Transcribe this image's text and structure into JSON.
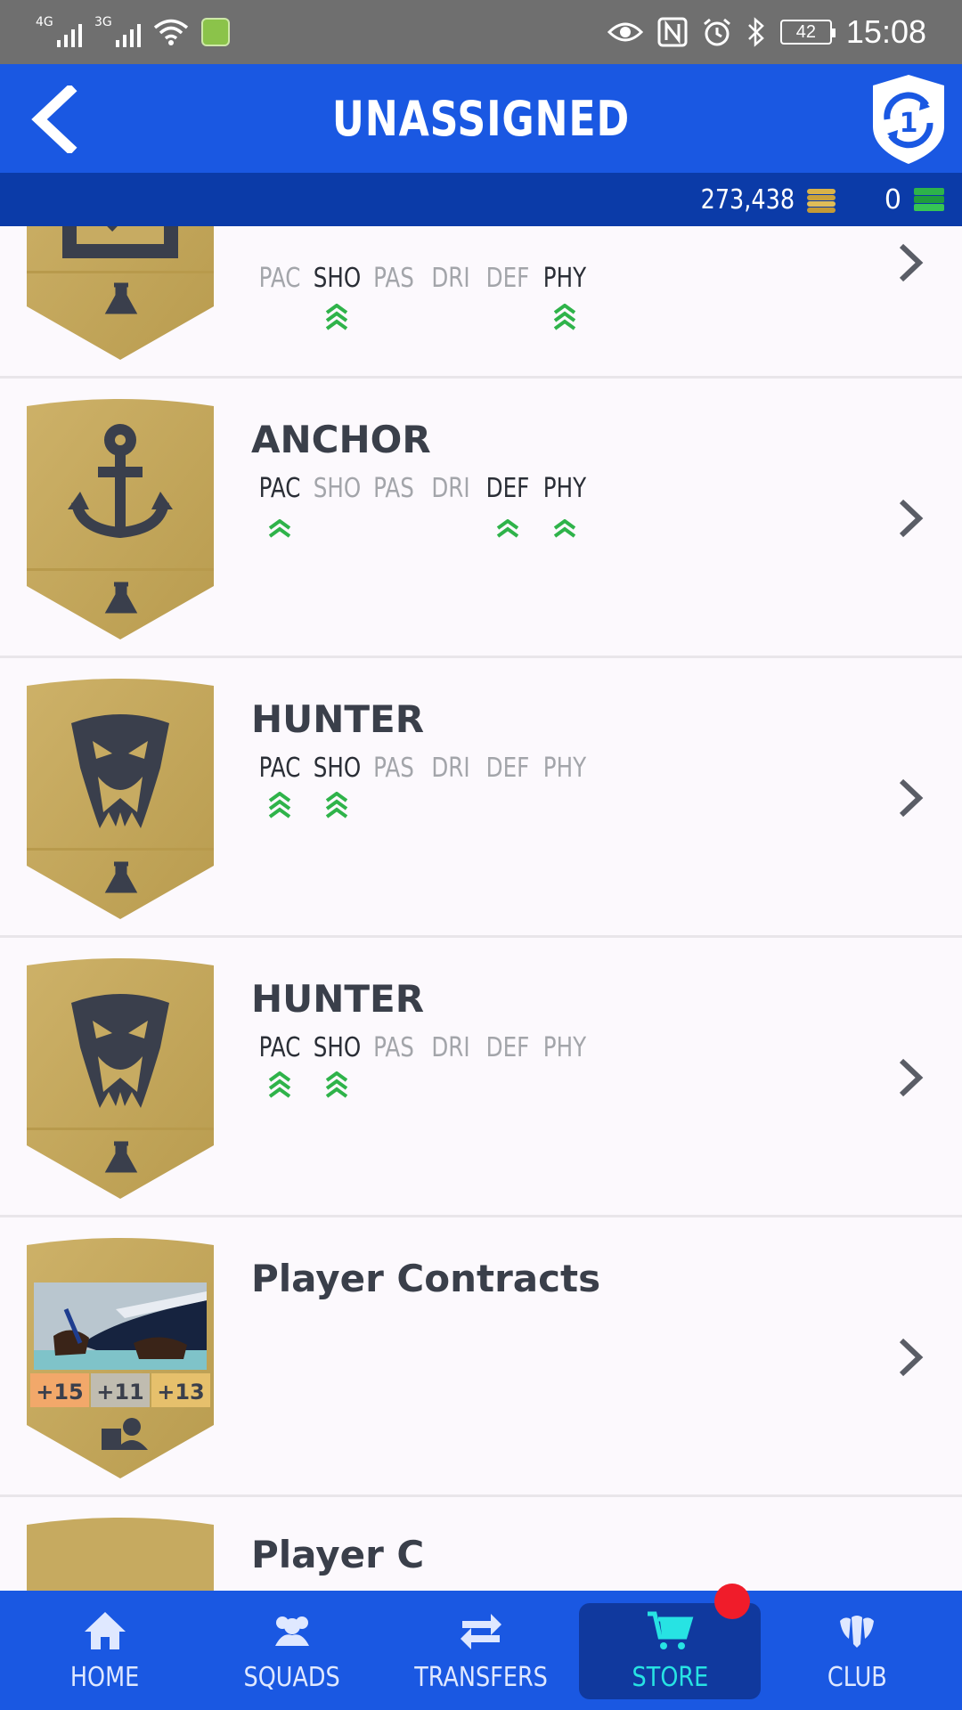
{
  "status_bar": {
    "network_1": "4G",
    "network_2": "3G",
    "battery": "42",
    "time": "15:08"
  },
  "header": {
    "title": "UNASSIGNED",
    "objective_badge": "1"
  },
  "currency": {
    "coins": "273,438",
    "points": "0"
  },
  "stat_labels": [
    "PAC",
    "SHO",
    "PAS",
    "DRI",
    "DEF",
    "PHY"
  ],
  "items": [
    {
      "name": "",
      "active": [
        false,
        true,
        false,
        false,
        false,
        true
      ],
      "boosts": [
        0,
        3,
        0,
        0,
        0,
        3
      ],
      "icon": "checklist-icon"
    },
    {
      "name": "ANCHOR",
      "active": [
        true,
        false,
        false,
        false,
        true,
        true
      ],
      "boosts": [
        2,
        0,
        0,
        0,
        2,
        2
      ],
      "icon": "anchor-icon"
    },
    {
      "name": "HUNTER",
      "active": [
        true,
        true,
        false,
        false,
        false,
        false
      ],
      "boosts": [
        3,
        3,
        0,
        0,
        0,
        0
      ],
      "icon": "snake-icon"
    },
    {
      "name": "HUNTER",
      "active": [
        true,
        true,
        false,
        false,
        false,
        false
      ],
      "boosts": [
        3,
        3,
        0,
        0,
        0,
        0
      ],
      "icon": "snake-icon"
    },
    {
      "name": "Player Contracts",
      "contract_values": [
        "+15",
        "+11",
        "+13"
      ],
      "icon": "contract-icon"
    },
    {
      "name": "Player C",
      "icon": "partial-card"
    }
  ],
  "nav": {
    "home": "HOME",
    "squads": "SQUADS",
    "transfers": "TRANSFERS",
    "store": "STORE",
    "club": "CLUB"
  },
  "colors": {
    "header": "#1a58e2",
    "currency_bar": "#0b3ba8",
    "card_gold": "#c8ab5c",
    "boost_green": "#2fb34a",
    "store_active": "#27e3e3",
    "notification": "#f01c2a"
  }
}
